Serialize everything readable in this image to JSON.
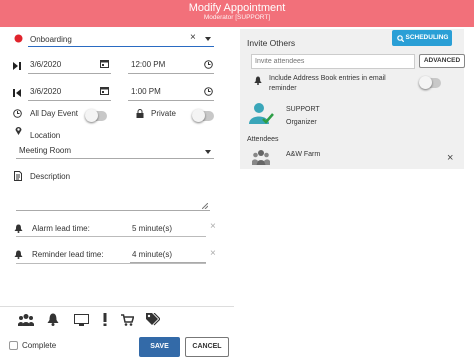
{
  "header": {
    "title": "Modify Appointment",
    "subtitle": "Moderator [SUPPORT]"
  },
  "form": {
    "title_value": "Onboarding",
    "start_date": "3/6/2020",
    "start_time": "12:00 PM",
    "end_date": "3/6/2020",
    "end_time": "1:00 PM",
    "all_day_label": "All Day Event",
    "private_label": "Private",
    "location_label": "Location",
    "location_value": "Meeting Room",
    "description_label": "Description",
    "alarm_label": "Alarm lead time:",
    "alarm_value": "5 minute(s)",
    "reminder_label": "Reminder lead time:",
    "reminder_value": "4 minute(s)"
  },
  "footer": {
    "complete_label": "Complete",
    "save_label": "SAVE",
    "cancel_label": "CANCEL"
  },
  "invite": {
    "title": "Invite Others",
    "scheduling_label": "SCHEDULING",
    "placeholder": "Invite attendees",
    "advanced_label": "ADVANCED",
    "address_book_label": "Include Address Book entries in email reminder",
    "organizer_name": "SUPPORT",
    "organizer_role": "Organizer",
    "attendees_label": "Attendees",
    "attendee_name": "A&W Farm"
  },
  "colors": {
    "header": "#f2707a",
    "accent": "#2a9fd6",
    "save": "#336aa8",
    "title_dot": "#e0232b",
    "organizer": "#3aa6b9"
  },
  "icons": [
    "red-dot-icon",
    "calendar-icon",
    "clock-icon",
    "skip-forward-icon",
    "skip-back-icon",
    "bell-icon",
    "lock-icon",
    "location-pin-icon",
    "document-icon",
    "group-icon",
    "monitor-icon",
    "exclamation-icon",
    "cart-icon",
    "tags-icon",
    "search-icon"
  ]
}
